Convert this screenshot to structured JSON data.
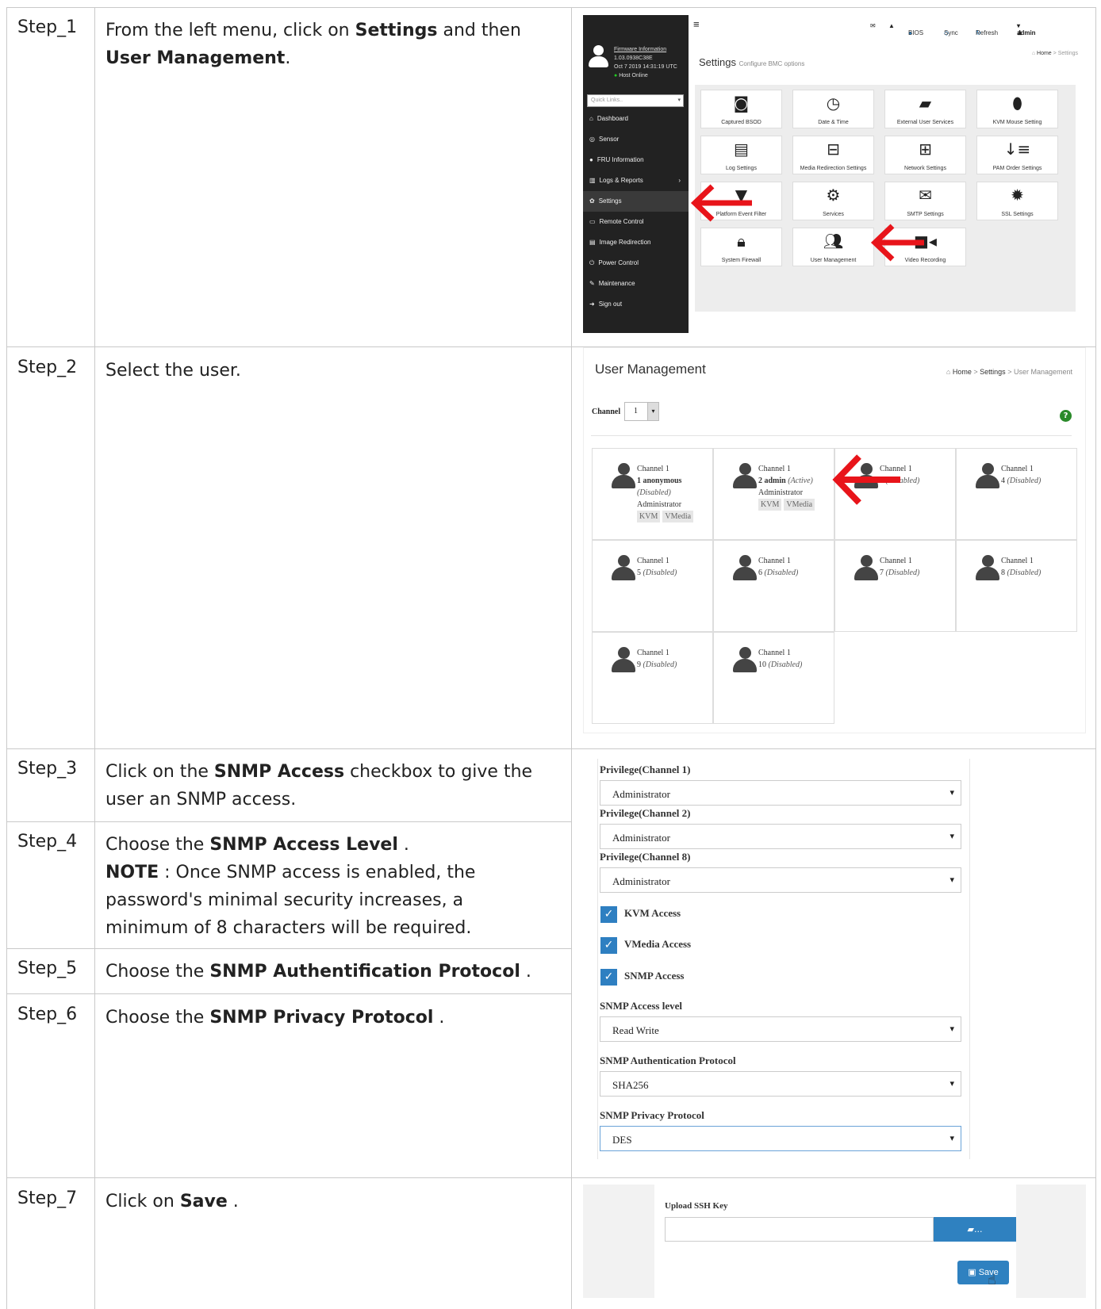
{
  "steps": [
    {
      "id": "Step_1",
      "text_pre": "From the left menu, click on ",
      "b1": "Settings",
      "text_mid": " and then",
      "b2": "User Management",
      "text_post": "."
    },
    {
      "id": "Step_2",
      "text": "Select the user."
    },
    {
      "id": "Step_3",
      "text_pre": "Click on the ",
      "b1": "SNMP Access",
      "text_post": " checkbox to give the user an SNMP access."
    },
    {
      "id": "Step_4",
      "text_pre": "Choose the ",
      "b1": "SNMP Access Level",
      "text_post": " .",
      "note_label": "NOTE",
      "note_text": " : Once SNMP access is enabled, the password's minimal security increases, a minimum of 8 characters will be required."
    },
    {
      "id": "Step_5",
      "text_pre": "Choose the ",
      "b1": "SNMP Authentification Protocol",
      "text_post": " ."
    },
    {
      "id": "Step_6",
      "text_pre": "Choose the ",
      "b1": "SNMP Privacy Protocol",
      "text_post": " ."
    },
    {
      "id": "Step_7",
      "text_pre": "Click on ",
      "b1": "Save",
      "text_post": " ."
    }
  ],
  "settings_shot": {
    "firmware_link": "Firmware Information",
    "firmware_version": "1.03.0938C38E",
    "firmware_date": "Oct 7 2019 14:31:19 UTC",
    "host_status": "Host Online",
    "quick_links": "Quick Links..",
    "menu": [
      "Dashboard",
      "Sensor",
      "FRU Information",
      "Logs & Reports",
      "Settings",
      "Remote Control",
      "Image Redirection",
      "Power Control",
      "Maintenance",
      "Sign out"
    ],
    "top": {
      "bios": "BIOS",
      "sync": "Sync",
      "refresh": "Refresh",
      "user": "admin"
    },
    "title": "Settings",
    "subtitle": "Configure BMC options",
    "crumb_home": "Home",
    "crumb_current": "Settings",
    "tiles": [
      "Captured BSOD",
      "Date & Time",
      "External User Services",
      "KVM Mouse Setting",
      "Log Settings",
      "Media Redirection Settings",
      "Network Settings",
      "PAM Order Settings",
      "Platform Event Filter",
      "Services",
      "SMTP Settings",
      "SSL Settings",
      "System Firewall",
      "User Management",
      "Video Recording"
    ]
  },
  "user_shot": {
    "title": "User Management",
    "crumb": [
      "Home",
      "Settings",
      "User Management"
    ],
    "channel_label": "Channel",
    "channel_value": "1",
    "users": [
      {
        "channel": "Channel 1",
        "name": "1 anonymous",
        "status": "(Disabled)",
        "role": "Administrator",
        "tags": [
          "KVM",
          "VMedia"
        ]
      },
      {
        "channel": "Channel 1",
        "name": "2 admin",
        "status": "(Active)",
        "role": "Administrator",
        "tags": [
          "KVM",
          "VMedia"
        ]
      },
      {
        "channel": "Channel 1",
        "name": "3",
        "status": "(Disabled)"
      },
      {
        "channel": "Channel 1",
        "name": "4",
        "status": "(Disabled)"
      },
      {
        "channel": "Channel 1",
        "name": "5",
        "status": "(Disabled)"
      },
      {
        "channel": "Channel 1",
        "name": "6",
        "status": "(Disabled)"
      },
      {
        "channel": "Channel 1",
        "name": "7",
        "status": "(Disabled)"
      },
      {
        "channel": "Channel 1",
        "name": "8",
        "status": "(Disabled)"
      },
      {
        "channel": "Channel 1",
        "name": "9",
        "status": "(Disabled)"
      },
      {
        "channel": "Channel 1",
        "name": "10",
        "status": "(Disabled)"
      }
    ]
  },
  "form_shot": {
    "priv1_label": "Privilege(Channel 1)",
    "priv1_value": "Administrator",
    "priv2_label": "Privilege(Channel 2)",
    "priv2_value": "Administrator",
    "priv8_label": "Privilege(Channel 8)",
    "priv8_value": "Administrator",
    "kvm": "KVM Access",
    "vmedia": "VMedia Access",
    "snmp": "SNMP Access",
    "level_label": "SNMP Access level",
    "level_value": "Read Write",
    "auth_label": "SNMP Authentication Protocol",
    "auth_value": "SHA256",
    "priv_label": "SNMP Privacy Protocol",
    "priv_value": "DES"
  },
  "save_shot": {
    "ssh_label": "Upload SSH Key",
    "browse": "...",
    "save": "Save"
  },
  "colors": {
    "arrow": "#e8141a",
    "primary": "#2f81c0",
    "sidebar": "#222222"
  }
}
